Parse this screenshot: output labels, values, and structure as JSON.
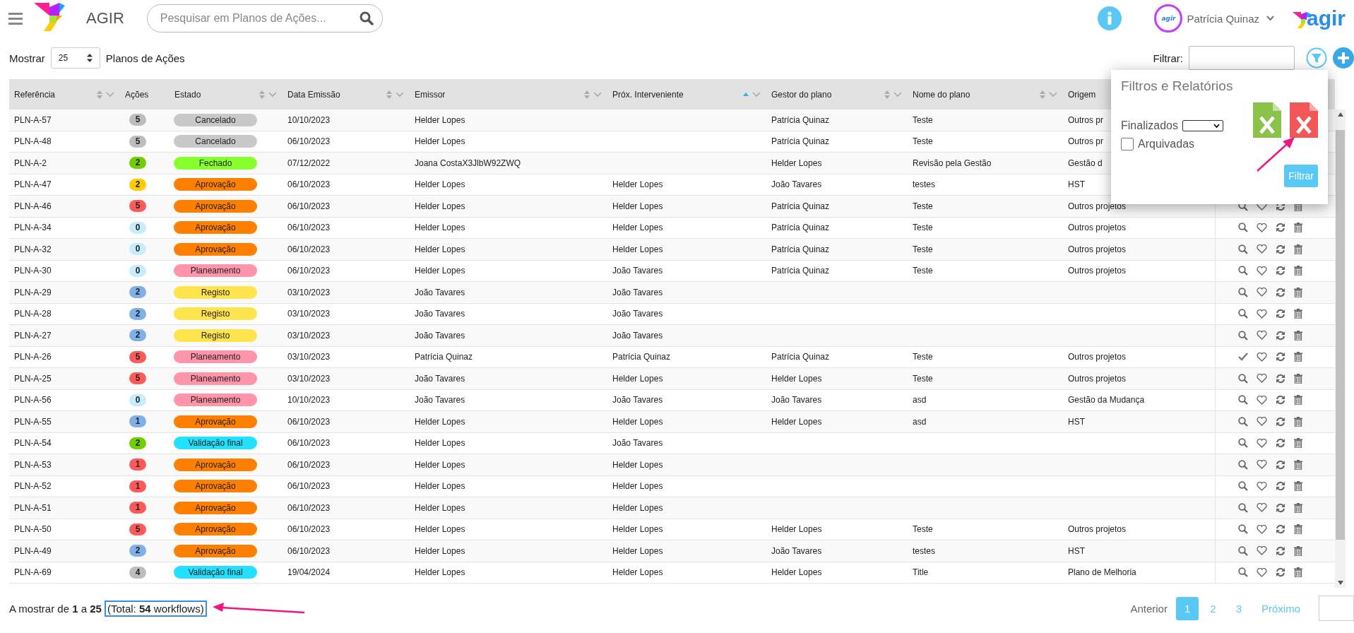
{
  "app": {
    "name": "AGIR",
    "search_placeholder": "Pesquisar em Planos de Ações...",
    "user": "Patrícia Quinaz",
    "avatar_text": "agir",
    "logo_text": "agir"
  },
  "toolbar": {
    "show_label": "Mostrar",
    "page_size": "25",
    "items_label": "Planos de Ações",
    "filter_label": "Filtrar:"
  },
  "columns": [
    {
      "label": "Referência",
      "sorted_ascending": false
    },
    {
      "label": "Ações"
    },
    {
      "label": "Estado",
      "sorted_ascending": false
    },
    {
      "label": "Data Emissão",
      "sorted_ascending": false
    },
    {
      "label": "Emissor",
      "sorted_ascending": false
    },
    {
      "label": "Próx. Interveniente",
      "sorted_ascending": true
    },
    {
      "label": "Gestor do plano",
      "sorted_ascending": false
    },
    {
      "label": "Nome do plano",
      "sorted_ascending": false
    },
    {
      "label": "Origem"
    }
  ],
  "rows": [
    {
      "ref": "PLN-A-57",
      "count": {
        "text": "5",
        "color": "#bdbdbd"
      },
      "state": {
        "label": "Cancelado",
        "color": "#c8c8c8"
      },
      "date": "10/10/2023",
      "issuer": "Helder Lopes",
      "manager": "Patrícia Quinaz",
      "plan": "Teste",
      "origin": "Outros pr"
    },
    {
      "ref": "PLN-A-48",
      "count": {
        "text": "5",
        "color": "#bdbdbd"
      },
      "state": {
        "label": "Cancelado",
        "color": "#c8c8c8"
      },
      "date": "06/10/2023",
      "issuer": "Helder Lopes",
      "manager": "Patrícia Quinaz",
      "plan": "Teste",
      "origin": "Outros pr"
    },
    {
      "ref": "PLN-A-2",
      "count": {
        "text": "2",
        "color": "#6fd000"
      },
      "state": {
        "label": "Fechado",
        "color": "#88ff2e"
      },
      "date": "07/12/2022",
      "issuer": "Joana CostaX3JlbW92ZWQ",
      "manager": "Helder Lopes",
      "plan": "Revisão pela Gestão",
      "origin": "Gestão d"
    },
    {
      "ref": "PLN-A-47",
      "count": {
        "text": "2",
        "color": "#ffcc00"
      },
      "state": {
        "label": "Aprovação",
        "color": "#ff7f00"
      },
      "date": "06/10/2023",
      "issuer": "Helder Lopes",
      "next": "Helder Lopes",
      "manager": "João Tavares",
      "plan": "testes",
      "origin": "HST"
    },
    {
      "ref": "PLN-A-46",
      "count": {
        "text": "5",
        "color": "#ff5a5a"
      },
      "state": {
        "label": "Aprovação",
        "color": "#ff7f00"
      },
      "date": "06/10/2023",
      "issuer": "Helder Lopes",
      "next": "Helder Lopes",
      "manager": "Patrícia Quinaz",
      "plan": "Teste",
      "origin": "Outros projetos",
      "done": false
    },
    {
      "ref": "PLN-A-34",
      "count": {
        "text": "0",
        "color": "#c6ecfd"
      },
      "state": {
        "label": "Aprovação",
        "color": "#ff7f00"
      },
      "date": "06/10/2023",
      "issuer": "Helder Lopes",
      "next": "Helder Lopes",
      "manager": "Patrícia Quinaz",
      "plan": "Teste",
      "origin": "Outros projetos",
      "done": false
    },
    {
      "ref": "PLN-A-32",
      "count": {
        "text": "0",
        "color": "#c6ecfd"
      },
      "state": {
        "label": "Aprovação",
        "color": "#ff7f00"
      },
      "date": "06/10/2023",
      "issuer": "Helder Lopes",
      "next": "Helder Lopes",
      "manager": "Patrícia Quinaz",
      "plan": "Teste",
      "origin": "Outros projetos",
      "done": false
    },
    {
      "ref": "PLN-A-30",
      "count": {
        "text": "0",
        "color": "#c6ecfd"
      },
      "state": {
        "label": "Planeamento",
        "color": "#ff94aa"
      },
      "date": "06/10/2023",
      "issuer": "Helder Lopes",
      "next": "João Tavares",
      "manager": "Patrícia Quinaz",
      "plan": "Teste",
      "origin": "Outros projetos",
      "done": false
    },
    {
      "ref": "PLN-A-29",
      "count": {
        "text": "2",
        "color": "#80b0e8"
      },
      "state": {
        "label": "Registo",
        "color": "#ffe44d"
      },
      "date": "03/10/2023",
      "issuer": "João Tavares",
      "next": "João Tavares",
      "done": false
    },
    {
      "ref": "PLN-A-28",
      "count": {
        "text": "2",
        "color": "#80b0e8"
      },
      "state": {
        "label": "Registo",
        "color": "#ffe44d"
      },
      "date": "03/10/2023",
      "issuer": "João Tavares",
      "next": "João Tavares",
      "done": false
    },
    {
      "ref": "PLN-A-27",
      "count": {
        "text": "2",
        "color": "#80b0e8"
      },
      "state": {
        "label": "Registo",
        "color": "#ffe44d"
      },
      "date": "03/10/2023",
      "issuer": "João Tavares",
      "next": "João Tavares",
      "done": false
    },
    {
      "ref": "PLN-A-26",
      "count": {
        "text": "5",
        "color": "#ff5a5a"
      },
      "state": {
        "label": "Planeamento",
        "color": "#ff94aa"
      },
      "date": "03/10/2023",
      "issuer": "Patrícia Quinaz",
      "next": "Patrícia Quinaz",
      "manager": "Patrícia Quinaz",
      "plan": "Teste",
      "origin": "Outros projetos",
      "done": true
    },
    {
      "ref": "PLN-A-25",
      "count": {
        "text": "5",
        "color": "#ff5a5a"
      },
      "state": {
        "label": "Planeamento",
        "color": "#ff94aa"
      },
      "date": "03/10/2023",
      "issuer": "João Tavares",
      "next": "Helder Lopes",
      "manager": "Helder Lopes",
      "plan": "Teste",
      "origin": "Outros projetos",
      "done": false
    },
    {
      "ref": "PLN-A-56",
      "count": {
        "text": "0",
        "color": "#c6ecfd"
      },
      "state": {
        "label": "Planeamento",
        "color": "#ff94aa"
      },
      "date": "10/10/2023",
      "issuer": "João Tavares",
      "next": "João Tavares",
      "manager": "João Tavares",
      "plan": "asd",
      "origin": "Gestão da Mudança",
      "done": false
    },
    {
      "ref": "PLN-A-55",
      "count": {
        "text": "1",
        "color": "#80b0e8"
      },
      "state": {
        "label": "Aprovação",
        "color": "#ff7f00"
      },
      "date": "06/10/2023",
      "issuer": "Helder Lopes",
      "next": "Helder Lopes",
      "manager": "Helder Lopes",
      "plan": "asd",
      "origin": "HST",
      "done": false
    },
    {
      "ref": "PLN-A-54",
      "count": {
        "text": "2",
        "color": "#6fd000"
      },
      "state": {
        "label": "Validação final",
        "color": "#22e0ff"
      },
      "date": "06/10/2023",
      "issuer": "Helder Lopes",
      "next": "João Tavares",
      "done": false
    },
    {
      "ref": "PLN-A-53",
      "count": {
        "text": "1",
        "color": "#ff5a5a"
      },
      "state": {
        "label": "Aprovação",
        "color": "#ff7f00"
      },
      "date": "06/10/2023",
      "issuer": "Helder Lopes",
      "next": "Helder Lopes",
      "done": false
    },
    {
      "ref": "PLN-A-52",
      "count": {
        "text": "1",
        "color": "#ff5a5a"
      },
      "state": {
        "label": "Aprovação",
        "color": "#ff7f00"
      },
      "date": "06/10/2023",
      "issuer": "Helder Lopes",
      "next": "Helder Lopes",
      "done": false
    },
    {
      "ref": "PLN-A-51",
      "count": {
        "text": "1",
        "color": "#ff5a5a"
      },
      "state": {
        "label": "Aprovação",
        "color": "#ff7f00"
      },
      "date": "06/10/2023",
      "issuer": "Helder Lopes",
      "next": "Helder Lopes",
      "done": false
    },
    {
      "ref": "PLN-A-50",
      "count": {
        "text": "5",
        "color": "#ff5a5a"
      },
      "state": {
        "label": "Aprovação",
        "color": "#ff7f00"
      },
      "date": "06/10/2023",
      "issuer": "Helder Lopes",
      "next": "Helder Lopes",
      "manager": "Helder Lopes",
      "plan": "Teste",
      "origin": "Outros projetos",
      "done": false
    },
    {
      "ref": "PLN-A-49",
      "count": {
        "text": "2",
        "color": "#80b0e8"
      },
      "state": {
        "label": "Aprovação",
        "color": "#ff7f00"
      },
      "date": "06/10/2023",
      "issuer": "Helder Lopes",
      "next": "Helder Lopes",
      "manager": "João Tavares",
      "plan": "testes",
      "origin": "HST",
      "done": false
    },
    {
      "ref": "PLN-A-69",
      "count": {
        "text": "4",
        "color": "#bdbdbd"
      },
      "state": {
        "label": "Validação final",
        "color": "#22e0ff"
      },
      "date": "19/04/2024",
      "issuer": "Helder Lopes",
      "next": "Helder Lopes",
      "manager": "Helder Lopes",
      "plan": "Title",
      "origin": "Plano de Melhoria",
      "done": false
    }
  ],
  "popup": {
    "title": "Filtros e Relatórios",
    "finalized_label": "Finalizados",
    "archived_label": "Arquivadas",
    "archived_checked": false,
    "button": "Filtrar"
  },
  "footer": {
    "summary": "A mostrar de **1** a **25**",
    "total": "(Total: **54** workflows)"
  },
  "pagination": {
    "previous": "Anterior",
    "previous_disabled": true,
    "pages": [
      {
        "label": "1",
        "selected": true
      },
      {
        "label": "2",
        "selected": false
      },
      {
        "label": "3",
        "selected": false
      }
    ],
    "next": "Próximo"
  }
}
